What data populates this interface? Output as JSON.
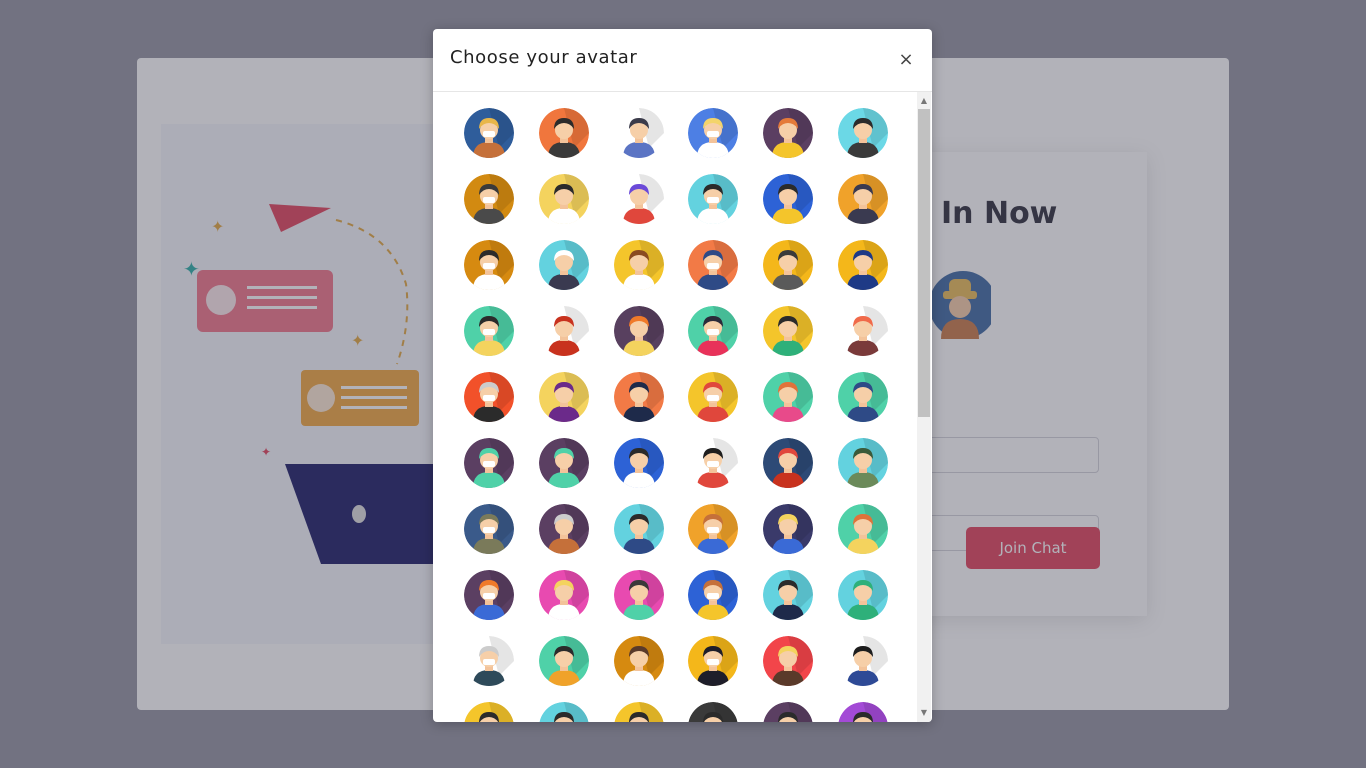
{
  "background": {
    "login_title": "In Now",
    "join_button": "Join Chat"
  },
  "modal": {
    "title": "Choose your avatar",
    "close_symbol": "×"
  },
  "avatars": [
    {
      "bg": "#2f5d9b",
      "hair": "#e8b64a",
      "shirt": "#c5703a"
    },
    {
      "bg": "#f0763d",
      "hair": "#2b2b2b",
      "shirt": "#3a3a3a"
    },
    {
      "bg": "#ffffff",
      "hair": "#3b3b4a",
      "shirt": "#5b74c4"
    },
    {
      "bg": "#4d7fe4",
      "hair": "#f3d46b",
      "shirt": "#ffffff"
    },
    {
      "bg": "#5b3f62",
      "hair": "#e47a3a",
      "shirt": "#f4c52b"
    },
    {
      "bg": "#6bd8e6",
      "hair": "#2b2b2b",
      "shirt": "#3a3a3a"
    },
    {
      "bg": "#d28a11",
      "hair": "#3a3a3a",
      "shirt": "#4a4a4a"
    },
    {
      "bg": "#f4d35e",
      "hair": "#2b2b2b",
      "shirt": "#ffffff"
    },
    {
      "bg": "#ffffff",
      "hair": "#6b4ad8",
      "shirt": "#e0473c"
    },
    {
      "bg": "#63d2df",
      "hair": "#2b2b2b",
      "shirt": "#ffffff"
    },
    {
      "bg": "#2d62d6",
      "hair": "#2b2b2b",
      "shirt": "#f4c52b"
    },
    {
      "bg": "#f0a22a",
      "hair": "#3a3a50",
      "shirt": "#3a3a50"
    },
    {
      "bg": "#d68a10",
      "hair": "#2b2b2b",
      "shirt": "#ffffff"
    },
    {
      "bg": "#63d2df",
      "hair": "#ffffff",
      "shirt": "#3a3a50"
    },
    {
      "bg": "#f4c52b",
      "hair": "#8a4a20",
      "shirt": "#ffffff"
    },
    {
      "bg": "#f27a46",
      "hair": "#2e4a86",
      "shirt": "#2e4a86"
    },
    {
      "bg": "#f4b71a",
      "hair": "#3a3a3a",
      "shirt": "#5a5a5a"
    },
    {
      "bg": "#f4b71a",
      "hair": "#1e3a86",
      "shirt": "#1e3a86"
    },
    {
      "bg": "#4fd1a8",
      "hair": "#2b2b2b",
      "shirt": "#f4d35e"
    },
    {
      "bg": "#ffffff",
      "hair": "#c8321e",
      "shirt": "#c8321e"
    },
    {
      "bg": "#58405f",
      "hair": "#f07a2a",
      "shirt": "#f4d35e"
    },
    {
      "bg": "#4fd1a8",
      "hair": "#2b2b3a",
      "shirt": "#e8325a"
    },
    {
      "bg": "#f4c52b",
      "hair": "#2b2b2b",
      "shirt": "#2eb07a"
    },
    {
      "bg": "#ffffff",
      "hair": "#f06a4a",
      "shirt": "#7a3a3a"
    },
    {
      "bg": "#f2512a",
      "hair": "#cccccc",
      "shirt": "#2b2b2b"
    },
    {
      "bg": "#f4d35e",
      "hair": "#6b2a8a",
      "shirt": "#6b2a8a"
    },
    {
      "bg": "#f27a46",
      "hair": "#1e2a4a",
      "shirt": "#1e2a4a"
    },
    {
      "bg": "#f4c52b",
      "hair": "#e0473c",
      "shirt": "#e0473c"
    },
    {
      "bg": "#4fd1a8",
      "hair": "#e0733a",
      "shirt": "#e84a8a"
    },
    {
      "bg": "#4fd1a8",
      "hair": "#2e4a86",
      "shirt": "#2e4a86"
    },
    {
      "bg": "#5b3f62",
      "hair": "#4fd1a8",
      "shirt": "#4fd1a8"
    },
    {
      "bg": "#5b3f62",
      "hair": "#4fd1a8",
      "shirt": "#4fd1a8"
    },
    {
      "bg": "#2d62d6",
      "hair": "#2b2b2b",
      "shirt": "#ffffff"
    },
    {
      "bg": "#ffffff",
      "hair": "#1e1e1e",
      "shirt": "#e0473c"
    },
    {
      "bg": "#2d4a76",
      "hair": "#e0473c",
      "shirt": "#c8321e"
    },
    {
      "bg": "#63d2df",
      "hair": "#3a5a3a",
      "shirt": "#6b8a5a"
    },
    {
      "bg": "#3a5a8a",
      "hair": "#7a7a5a",
      "shirt": "#7a7a5a"
    },
    {
      "bg": "#5b3f62",
      "hair": "#cccccc",
      "shirt": "#c5703a"
    },
    {
      "bg": "#63d2df",
      "hair": "#2b2b2b",
      "shirt": "#2e4a86"
    },
    {
      "bg": "#f0a22a",
      "hair": "#c5703a",
      "shirt": "#3a6ad6"
    },
    {
      "bg": "#3a3a6a",
      "hair": "#f4d35e",
      "shirt": "#3a6ad6"
    },
    {
      "bg": "#4fd1a8",
      "hair": "#e0733a",
      "shirt": "#f4d35e"
    },
    {
      "bg": "#5b3f62",
      "hair": "#f07a2a",
      "shirt": "#3a6ad6"
    },
    {
      "bg": "#e84ab0",
      "hair": "#f4d35e",
      "shirt": "#ffffff"
    },
    {
      "bg": "#e84ab0",
      "hair": "#3a3a3a",
      "shirt": "#4fd1a8"
    },
    {
      "bg": "#2d62d6",
      "hair": "#c5703a",
      "shirt": "#f4c52b"
    },
    {
      "bg": "#63d2df",
      "hair": "#2b2b2b",
      "shirt": "#1e2a4a"
    },
    {
      "bg": "#63d2df",
      "hair": "#2eb07a",
      "shirt": "#2eb07a"
    },
    {
      "bg": "#ffffff",
      "hair": "#cccccc",
      "shirt": "#2e4a5a"
    },
    {
      "bg": "#4fd1a8",
      "hair": "#2b2b2b",
      "shirt": "#f0a22a"
    },
    {
      "bg": "#d68a10",
      "hair": "#5a3a2a",
      "shirt": "#ffffff"
    },
    {
      "bg": "#f4b71a",
      "hair": "#1e1e2a",
      "shirt": "#1e1e2a"
    },
    {
      "bg": "#f2454a",
      "hair": "#f4d35e",
      "shirt": "#5a3a2a"
    },
    {
      "bg": "#ffffff",
      "hair": "#1e1e1e",
      "shirt": "#2e4a96"
    },
    {
      "bg": "#f4c52b",
      "hair": "#2b2b2b",
      "shirt": "#2b2b2b"
    },
    {
      "bg": "#63d2df",
      "hair": "#2b2b2b",
      "shirt": "#2b2b2b"
    },
    {
      "bg": "#f4c52b",
      "hair": "#2b2b2b",
      "shirt": "#2b2b2b"
    },
    {
      "bg": "#3a3a3a",
      "hair": "#2b2b2b",
      "shirt": "#2b2b2b"
    },
    {
      "bg": "#5b3f62",
      "hair": "#2b2b2b",
      "shirt": "#2b2b2b"
    },
    {
      "bg": "#a34ad6",
      "hair": "#2b2b2b",
      "shirt": "#2b2b2b"
    }
  ]
}
